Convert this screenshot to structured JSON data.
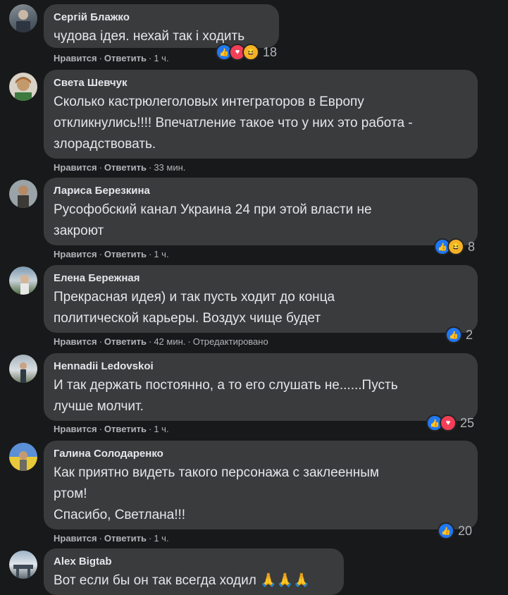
{
  "labels": {
    "like": "Нравится",
    "reply": "Ответить",
    "edited": "Отредактировано"
  },
  "comments": [
    {
      "author": "Сергій Блажко",
      "text": "чудова ідея. нехай так і ходить",
      "time": "1 ч.",
      "reactions": [
        "like",
        "love",
        "haha"
      ],
      "count": "18"
    },
    {
      "author": "Света Шевчук",
      "text": "Сколько кастрюлеголовых интеграторов в Европу\nоткликнулись!!!! Впечатление такое что у них это работа -\nзлорадствовать.",
      "time": "33 мин.",
      "reactions": [],
      "count": ""
    },
    {
      "author": "Лариса Березкина",
      "text": "Русофобский канал Украина 24 при этой власти не\nзакроют",
      "time": "1 ч.",
      "reactions": [
        "like",
        "haha"
      ],
      "count": "8"
    },
    {
      "author": "Елена Бережная",
      "text": "Прекрасная идея) и так пусть ходит до конца\nполитической карьеры. Воздух чище будет",
      "time": "42 мин.",
      "reactions": [
        "like"
      ],
      "count": "2"
    },
    {
      "author": "Hennadii Ledovskoi",
      "text": "И так держать постоянно, а то его слушать не......Пусть\nлучше молчит.",
      "time": "1 ч.",
      "reactions": [
        "like",
        "love"
      ],
      "count": "25"
    },
    {
      "author": "Галина Солодаренко",
      "text": "Как приятно видеть такого персонажа с заклеенным\nртом!\nСпасибо, Светлана!!!",
      "time": "1 ч.",
      "reactions": [
        "like"
      ],
      "count": "20"
    },
    {
      "author": "Alex Bigtab",
      "text": "Вот если бы он так всегда ходил 🙏🙏🙏",
      "time": "",
      "reactions": [],
      "count": ""
    }
  ],
  "colors": {
    "background": "#18191a",
    "bubble": "#3a3b3c",
    "like": "#2078f4",
    "love": "#f33e58",
    "haha": "#f7b125"
  }
}
